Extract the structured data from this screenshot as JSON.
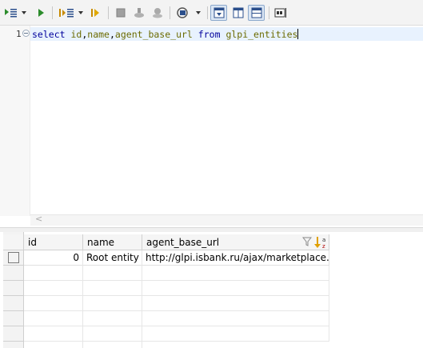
{
  "editor": {
    "line_number": "1",
    "tokens": [
      {
        "text": "select",
        "cls": "kw"
      },
      {
        "text": " ",
        "cls": "pn"
      },
      {
        "text": "id",
        "cls": "id"
      },
      {
        "text": ",",
        "cls": "pn"
      },
      {
        "text": "name",
        "cls": "id"
      },
      {
        "text": ",",
        "cls": "pn"
      },
      {
        "text": "agent_base_url",
        "cls": "id"
      },
      {
        "text": " ",
        "cls": "pn"
      },
      {
        "text": "from",
        "cls": "kw"
      },
      {
        "text": " ",
        "cls": "pn"
      },
      {
        "text": "glpi_entities",
        "cls": "id"
      }
    ]
  },
  "grid": {
    "columns": [
      "id",
      "name",
      "agent_base_url"
    ],
    "rows": [
      {
        "id": "0",
        "name": "Root entity",
        "agent_base_url": "http://glpi.isbank.ru/ajax/marketplace.php"
      }
    ]
  },
  "scroll": {
    "left_arrow": "<"
  },
  "colors": {
    "keyword": "#00009c",
    "identifier": "#6b6b00",
    "line_highlight": "#e8f2fe"
  }
}
